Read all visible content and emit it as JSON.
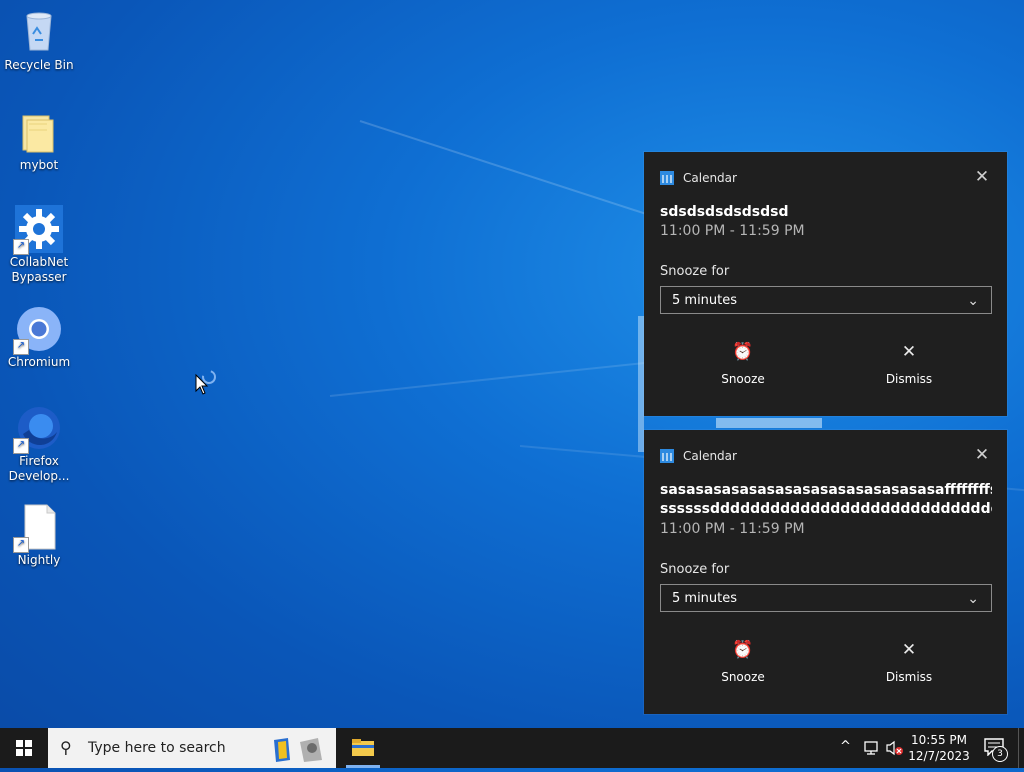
{
  "desktop": {
    "icons": [
      {
        "label": "Recycle Bin"
      },
      {
        "label": "mybot"
      },
      {
        "label": "CollabNet Bypasser"
      },
      {
        "label": "Chromium"
      },
      {
        "label": "Firefox Develop..."
      },
      {
        "label": "Nightly"
      }
    ]
  },
  "notifications": [
    {
      "app": "Calendar",
      "title": "sdsdsdsdsdsdsd",
      "time": "11:00 PM - 11:59 PM",
      "snooze_label": "Snooze for",
      "snooze_value": "5 minutes",
      "snooze_button": "Snooze",
      "dismiss_button": "Dismiss"
    },
    {
      "app": "Calendar",
      "title_line1": "sasasasasasasasasasasasasasasasaffffffffsssssssss",
      "title_line2": "ssssssdddddddddddddddddddddddddddddddddddd",
      "time": "11:00 PM - 11:59 PM",
      "snooze_label": "Snooze for",
      "snooze_value": "5 minutes",
      "snooze_button": "Snooze",
      "dismiss_button": "Dismiss"
    }
  ],
  "taskbar": {
    "search_placeholder": "Type here to search",
    "clock_time": "10:55 PM",
    "clock_date": "12/7/2023",
    "notification_count": "3"
  }
}
